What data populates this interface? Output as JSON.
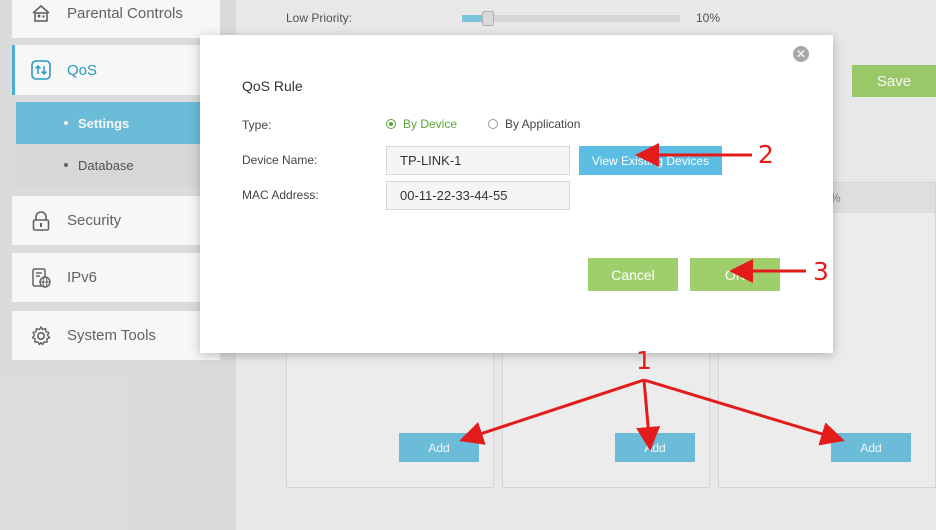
{
  "sidebar": {
    "items": [
      {
        "label": "Parental Controls",
        "icon": "parental-controls-icon"
      },
      {
        "label": "QoS",
        "icon": "qos-icon",
        "active": true
      },
      {
        "label": "Security",
        "icon": "lock-icon"
      },
      {
        "label": "IPv6",
        "icon": "ipv6-icon"
      },
      {
        "label": "System Tools",
        "icon": "gear-icon"
      }
    ],
    "subitems": [
      {
        "label": "Settings",
        "active": true
      },
      {
        "label": "Database"
      }
    ]
  },
  "main": {
    "low_priority_label": "Low Priority:",
    "low_priority_level": 0.12,
    "low_priority_value": "10%",
    "save_label": "Save",
    "panel_right_header_text": "%",
    "add_label": "Add"
  },
  "dialog": {
    "title": "QoS Rule",
    "type_label": "Type:",
    "type_options": [
      "By Device",
      "By Application"
    ],
    "type_selected": "By Device",
    "device_name_label": "Device Name:",
    "device_name_value": "TP-LINK-1",
    "mac_label": "MAC Address:",
    "mac_value": "00-11-22-33-44-55",
    "view_devices_label": "View Existing Devices",
    "cancel_label": "Cancel",
    "ok_label": "OK"
  },
  "annotations": {
    "numbers": [
      "1",
      "2",
      "3"
    ],
    "color": "#e31b1b"
  },
  "colors": {
    "accent_blue": "#6fc3df",
    "accent_green": "#9fcf6c",
    "active_text": "#2a9dc9"
  }
}
